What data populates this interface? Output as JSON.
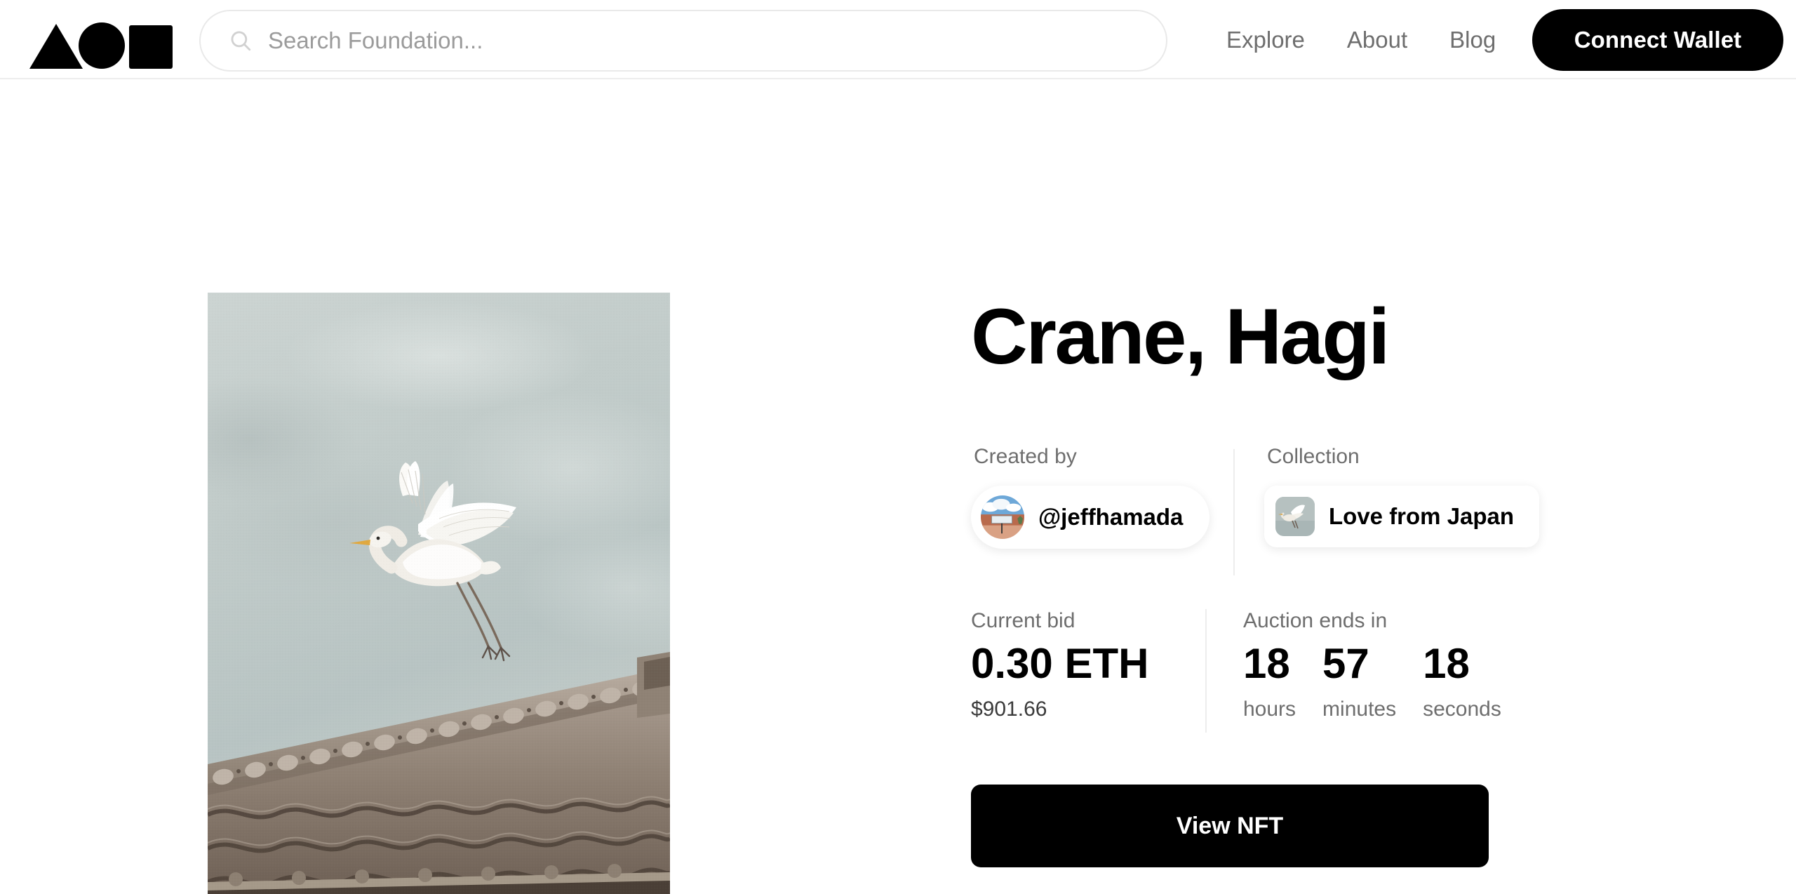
{
  "header": {
    "logo_name": "foundation-logo",
    "search": {
      "placeholder": "Search Foundation...",
      "value": "",
      "icon": "search-icon"
    },
    "nav_links": [
      {
        "label": "Explore"
      },
      {
        "label": "About"
      },
      {
        "label": "Blog"
      }
    ],
    "connect_wallet_label": "Connect Wallet"
  },
  "artwork": {
    "alt": "White crane in flight above a traditional Japanese tiled roof",
    "sky_color": "#c3ccca",
    "tile_color": "#8a7a6c"
  },
  "detail": {
    "title": "Crane, Hagi",
    "creator": {
      "label": "Created by",
      "handle": "@jeffhamada",
      "avatar_name": "creator-avatar"
    },
    "collection": {
      "label": "Collection",
      "name": "Love from Japan",
      "thumb_name": "collection-thumbnail"
    },
    "bid": {
      "label": "Current bid",
      "amount": "0.30 ETH",
      "usd": "$901.66"
    },
    "auction": {
      "label": "Auction ends in",
      "units": [
        {
          "value": "18",
          "label": "hours"
        },
        {
          "value": "57",
          "label": "minutes"
        },
        {
          "value": "18",
          "label": "seconds"
        }
      ]
    },
    "view_button_label": "View NFT"
  },
  "colors": {
    "accent": "#000000",
    "muted_text": "#6e6e6e",
    "border": "#ededed"
  }
}
